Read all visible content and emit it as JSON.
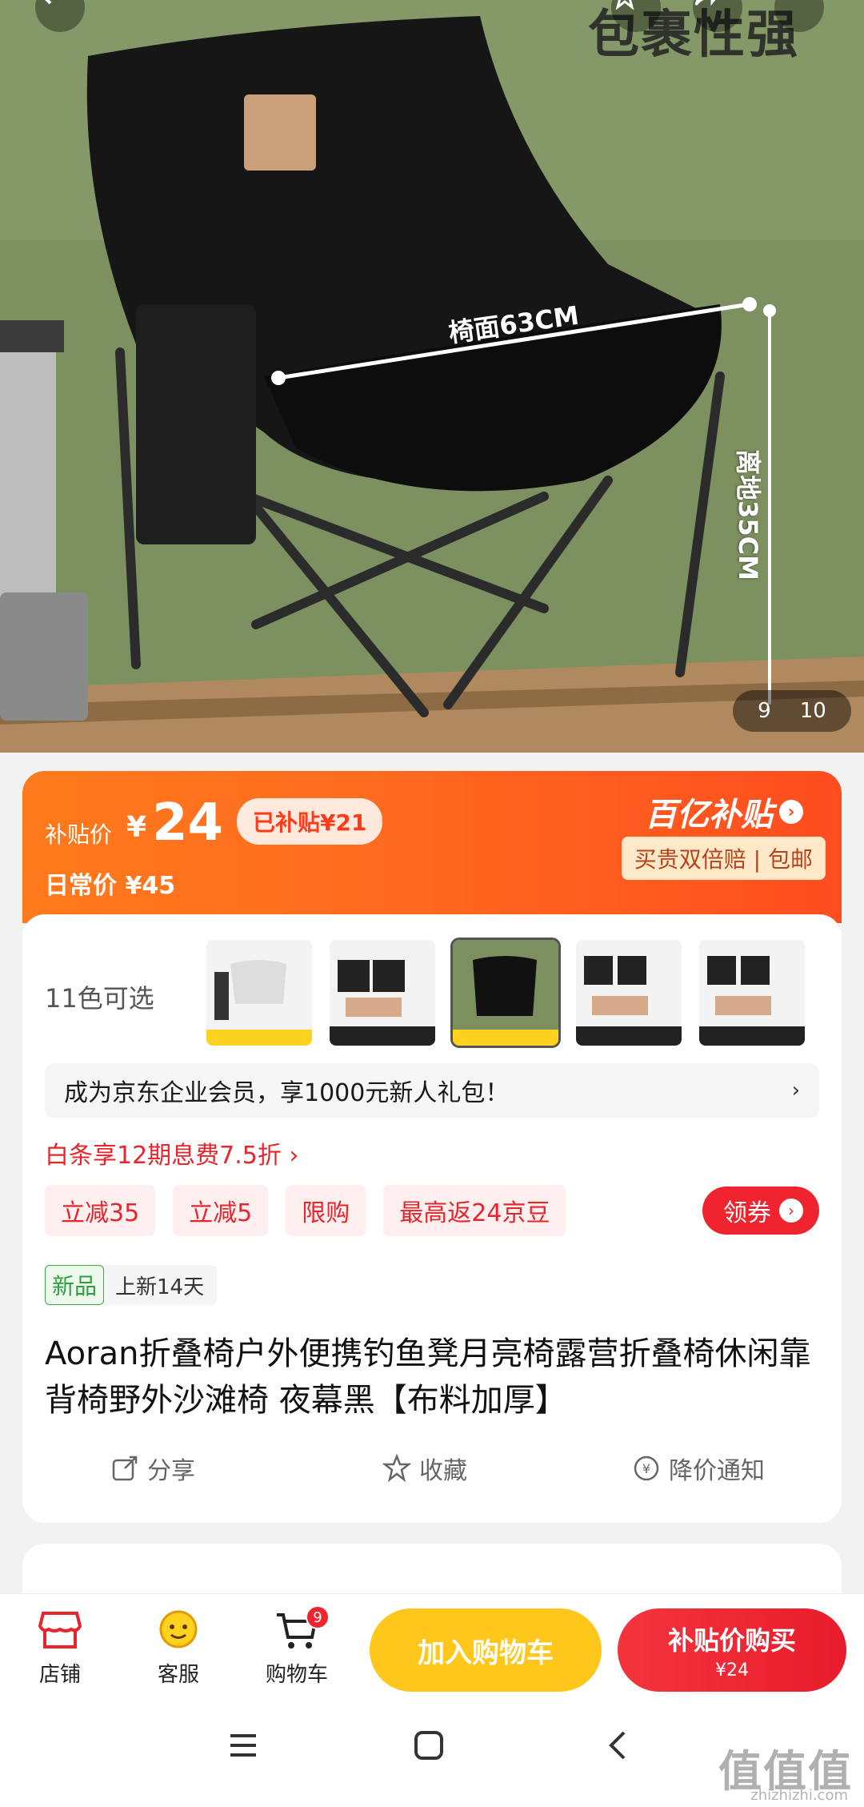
{
  "hero": {
    "slogan": "包裹性强",
    "seat_width_label": "椅面63CM",
    "height_label": "离地35CM",
    "counter_current": "9",
    "counter_total": "10"
  },
  "price": {
    "label": "补贴价",
    "currency": "¥",
    "amount": "24",
    "subsidy_badge": "已补贴¥21",
    "daily_price": "日常价 ¥45",
    "brand": "百亿补贴",
    "brand_tags": "买贵双倍赔 | 包邮"
  },
  "variants": {
    "label": "11色可选"
  },
  "member_bar": {
    "text": "成为京东企业会员，享1000元新人礼包！",
    "chevron": "›"
  },
  "baitiao": "白条享12期息费7.5折 ›",
  "promos": [
    "立减35",
    "立减5",
    "限购",
    "最高返24京豆"
  ],
  "coupon_button": "领券",
  "new_arrival": {
    "tag": "新品",
    "text": "上新14天"
  },
  "title": "Aoran折叠椅户外便携钓鱼凳月亮椅露营折叠椅休闲靠背椅野外沙滩椅  夜幕黑【布料加厚】",
  "actions": {
    "share": "分享",
    "favorite": "收藏",
    "notify": "降价通知"
  },
  "bottom_bar": {
    "store": "店铺",
    "service": "客服",
    "cart": "购物车",
    "cart_count": "9",
    "add_to_cart": "加入购物车",
    "buy_line1": "补贴价购买",
    "buy_line2": "¥24"
  },
  "watermark": {
    "logo": "值值值",
    "site": "zhizhizhi.com"
  },
  "colors": {
    "accent_orange": "#ff6a1f",
    "accent_red": "#f0242e",
    "cart_yellow": "#ffc71c"
  }
}
